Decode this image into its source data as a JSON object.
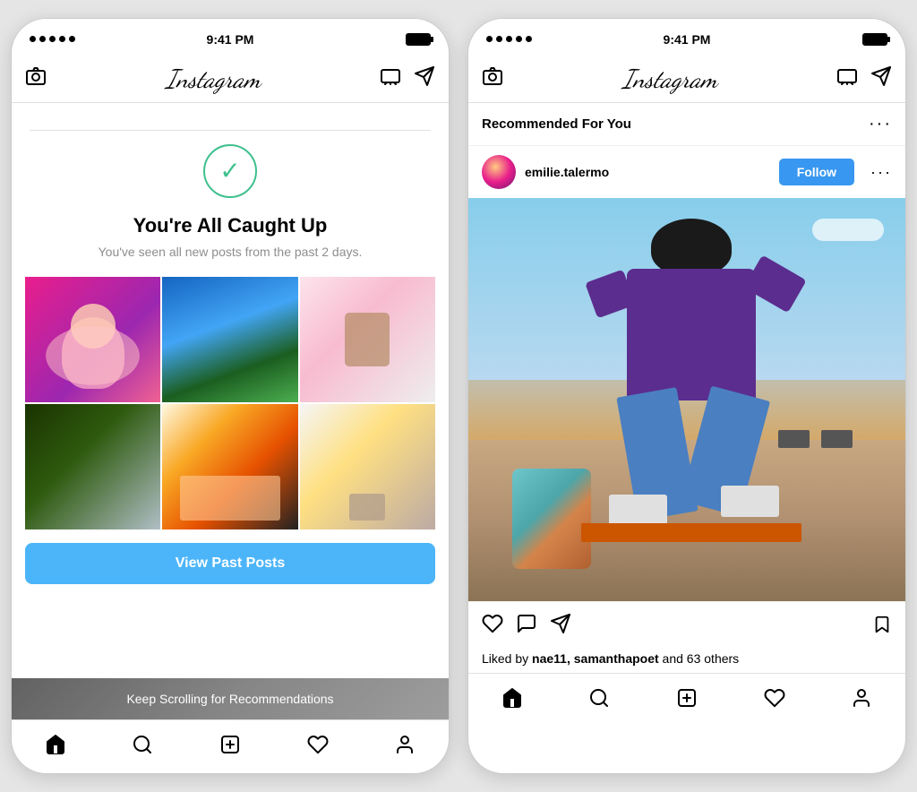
{
  "left_phone": {
    "status": {
      "time": "9:41 PM",
      "dots": 5
    },
    "header": {
      "logo": "Instagram",
      "tv_icon": "tv",
      "send_icon": "send"
    },
    "caught_up": {
      "title": "You're All Caught Up",
      "subtitle": "You've seen all new posts from the past 2 days."
    },
    "view_past_btn": "View Past Posts",
    "keep_scrolling": "Keep Scrolling for Recommendations",
    "nav": {
      "home": "home",
      "search": "search",
      "add": "add",
      "heart": "heart",
      "profile": "profile"
    }
  },
  "right_phone": {
    "status": {
      "time": "9:41 PM",
      "dots": 5
    },
    "header": {
      "logo": "Instagram",
      "tv_icon": "tv",
      "send_icon": "send"
    },
    "recommended": {
      "title": "Recommended For You",
      "dots": "..."
    },
    "post": {
      "username": "emilie.talermo",
      "follow_btn": "Follow",
      "likes": "Liked by ",
      "liked_by": "nae11, samanthapoet",
      "and_others": " and 63 others"
    },
    "nav": {
      "home": "home",
      "search": "search",
      "add": "add",
      "heart": "heart",
      "profile": "profile"
    }
  }
}
